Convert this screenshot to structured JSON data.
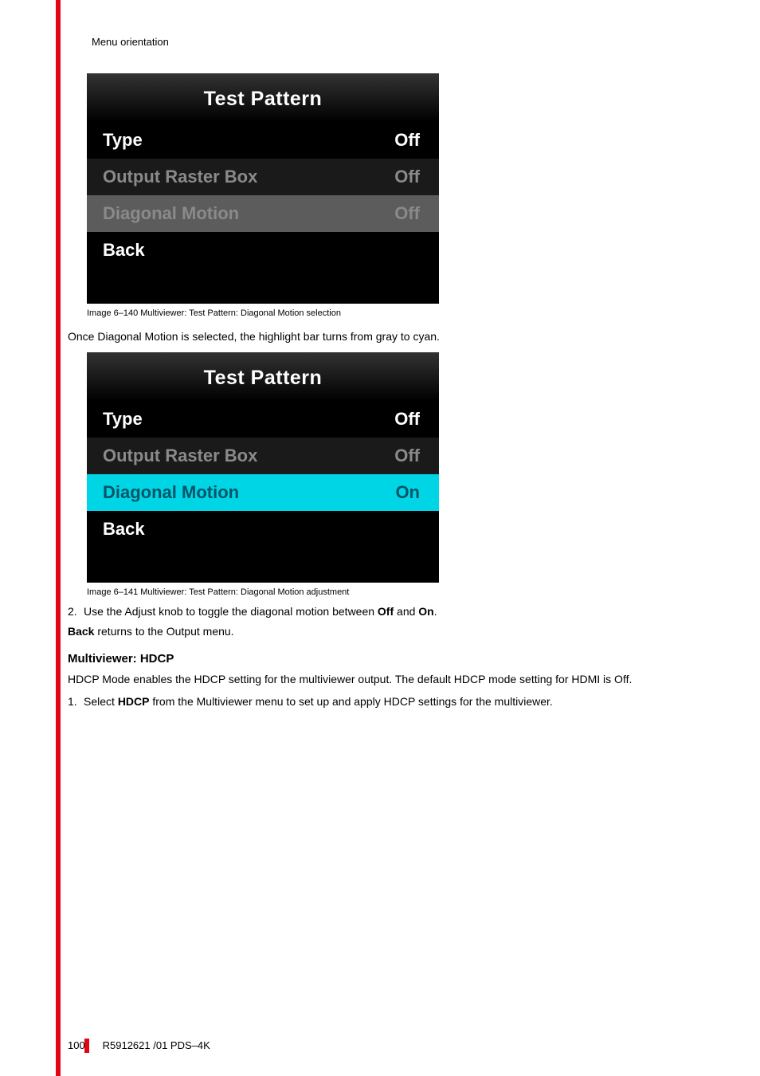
{
  "breadcrumb": "Menu orientation",
  "menu1": {
    "title": "Test Pattern",
    "rows": [
      {
        "label": "Type",
        "value": "Off"
      },
      {
        "label": "Output Raster Box",
        "value": "Off"
      },
      {
        "label": "Diagonal Motion",
        "value": "Off"
      },
      {
        "label": "Back",
        "value": ""
      }
    ]
  },
  "caption1": "Image 6–140  Multiviewer: Test Pattern: Diagonal Motion selection",
  "para1": "Once Diagonal Motion is selected, the highlight bar turns from gray to cyan.",
  "menu2": {
    "title": "Test Pattern",
    "rows": [
      {
        "label": "Type",
        "value": "Off"
      },
      {
        "label": "Output Raster Box",
        "value": "Off"
      },
      {
        "label": "Diagonal Motion",
        "value": "On"
      },
      {
        "label": "Back",
        "value": ""
      }
    ]
  },
  "caption2": "Image 6–141  Multiviewer: Test Pattern: Diagonal Motion adjustment",
  "step2_pre": "Use the Adjust knob to toggle the diagonal motion between ",
  "step2_off": "Off",
  "step2_mid": " and ",
  "step2_on": "On",
  "step2_post": ".",
  "back_line_pre": "Back",
  "back_line_post": " returns to the Output menu.",
  "subhead": "Multiviewer: HDCP",
  "hdcp_para": "HDCP Mode enables the HDCP setting for the multiviewer output. The default HDCP mode setting for HDMI is Off.",
  "step1b_pre": "Select ",
  "step1b_bold": "HDCP",
  "step1b_post": " from the Multiviewer menu to set up and apply HDCP settings for the multiviewer.",
  "footer": {
    "page": "100",
    "doc": "R5912621 /01 PDS–4K"
  }
}
